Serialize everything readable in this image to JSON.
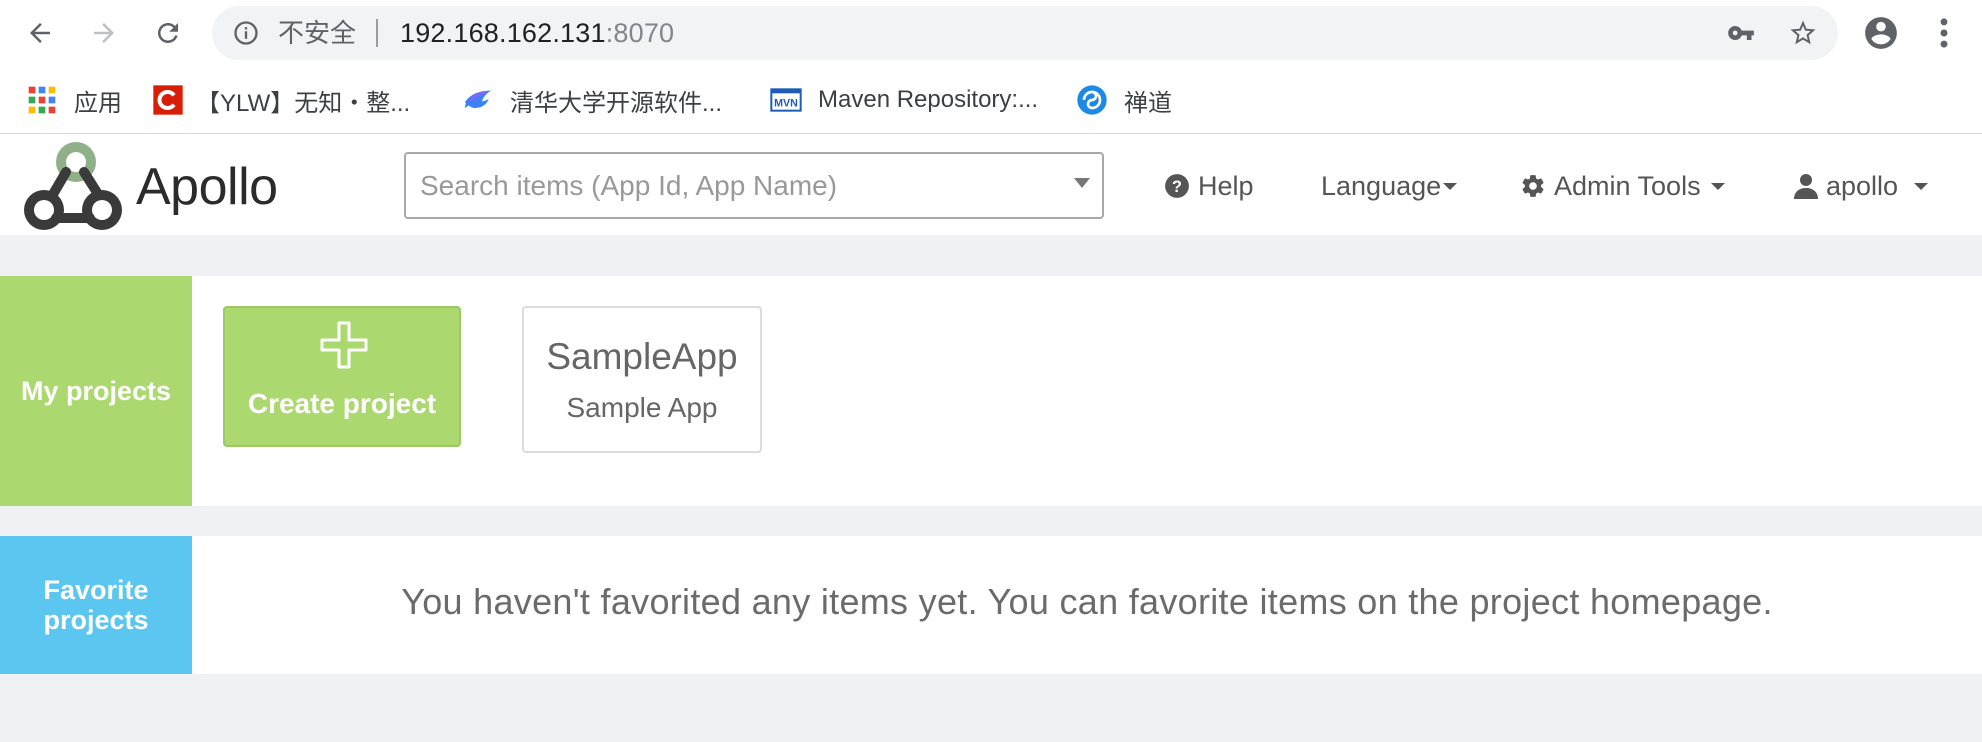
{
  "browser": {
    "security_label": "不安全",
    "url_host": "192.168.162.131",
    "url_port": ":8070",
    "bookmarks": [
      {
        "label": "应用",
        "icon": "apps-grid-icon"
      },
      {
        "label": "【YLW】无知・整...",
        "icon": "csdn-icon"
      },
      {
        "label": "清华大学开源软件...",
        "icon": "tuna-icon"
      },
      {
        "label": "Maven Repository:...",
        "icon": "mvn-icon"
      },
      {
        "label": "禅道",
        "icon": "zentao-icon"
      }
    ]
  },
  "header": {
    "brand": "Apollo",
    "search_placeholder": "Search items (App Id, App Name)",
    "nav": {
      "help": "Help",
      "language": "Language",
      "admin_tools": "Admin Tools",
      "user": "apollo"
    }
  },
  "my_projects": {
    "label": "My projects",
    "create_label": "Create project",
    "apps": [
      {
        "app_id": "SampleApp",
        "name": "Sample App"
      }
    ]
  },
  "favorites": {
    "label": "Favorite projects",
    "empty_message": "You haven't favorited any items yet. You can favorite items on the project homepage."
  },
  "colors": {
    "my_projects_accent": "#acd96f",
    "favorites_accent": "#5bc6f0",
    "background": "#f0f1f5"
  }
}
